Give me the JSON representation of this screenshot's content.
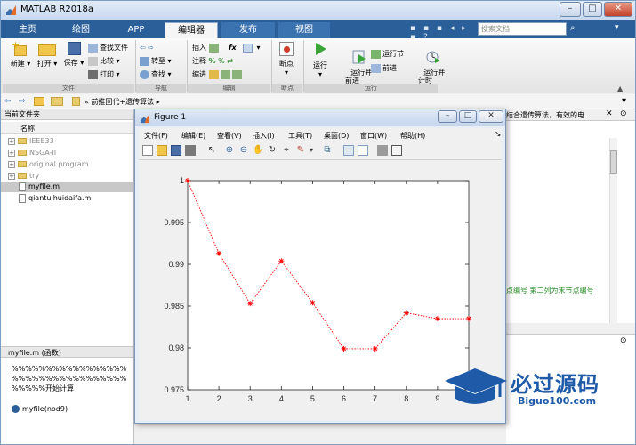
{
  "window": {
    "title": "MATLAB R2018a"
  },
  "tabs": [
    {
      "label": "主页"
    },
    {
      "label": "绘图"
    },
    {
      "label": "APP"
    },
    {
      "label": "编辑器"
    },
    {
      "label": "发布"
    },
    {
      "label": "视图"
    }
  ],
  "search": {
    "placeholder": "搜索文档"
  },
  "ribbon": {
    "file_group": {
      "label": "文件",
      "new": "新建",
      "open": "打开",
      "save": "保存",
      "find_file": "查找文件",
      "compare": "比较",
      "print": "打印"
    },
    "nav_group": {
      "label": "导航",
      "goto": "转至",
      "find": "查找"
    },
    "edit_group": {
      "label": "编辑",
      "insert": "插入",
      "comment": "注释",
      "indent": "缩进",
      "fx": "fx"
    },
    "breakpoint_group": {
      "label": "断点",
      "breakpoints": "断点"
    },
    "run_group": {
      "label": "运行",
      "run": "运行",
      "run_advance": "运行并\n前进",
      "run_section": "运行节",
      "advance": "前进",
      "run_time": "运行并\n计时"
    }
  },
  "address": {
    "path": "« 前推回代+遗传算法 ▸"
  },
  "left_panel": {
    "title": "当前文件夹",
    "column_name": "名称",
    "items": [
      {
        "name": "IEEE33",
        "type": "folder"
      },
      {
        "name": "NSGA-II",
        "type": "folder"
      },
      {
        "name": "original program",
        "type": "folder"
      },
      {
        "name": "try",
        "type": "folder"
      },
      {
        "name": "myfile.m",
        "type": "file"
      },
      {
        "name": "qiantuihuidaifa.m",
        "type": "file"
      }
    ],
    "details_title": "myfile.m  (函数)",
    "details_text": "%%%%%%%%%%%%%%%%%%%%%%%%%%%%%%%%%%%%%%%开始计算",
    "details_function": "myfile(nod9)"
  },
  "right_panel": {
    "header_text": "结合遗传算法，有效的电...",
    "code_comment": "点编号  第二列为末节点编号"
  },
  "figure": {
    "title": "Figure 1",
    "menus": [
      {
        "label": "文件(F)"
      },
      {
        "label": "编辑(E)"
      },
      {
        "label": "查看(V)"
      },
      {
        "label": "插入(I)"
      },
      {
        "label": "工具(T)"
      },
      {
        "label": "桌面(D)"
      },
      {
        "label": "窗口(W)"
      },
      {
        "label": "帮助(H)"
      }
    ]
  },
  "watermark": {
    "text": "必过源码",
    "url": "Biguo100.com"
  },
  "chart_data": {
    "type": "line",
    "title": "",
    "xlabel": "",
    "ylabel": "",
    "x": [
      1,
      2,
      3,
      4,
      5,
      6,
      7,
      8,
      9,
      10
    ],
    "series": [
      {
        "values": [
          1.0,
          0.9913,
          0.9853,
          0.9904,
          0.9854,
          0.9799,
          0.9799,
          0.9842,
          0.9835,
          0.9835
        ],
        "color": "#ff0000",
        "marker": "*",
        "line_style": "dotted"
      }
    ],
    "xlim": [
      1,
      10
    ],
    "ylim": [
      0.975,
      1.0
    ],
    "xticks": [
      "1",
      "2",
      "3",
      "4",
      "5",
      "6",
      "7",
      "8",
      "9"
    ],
    "yticks": [
      "0.975",
      "0.98",
      "0.985",
      "0.99",
      "0.995",
      "1"
    ],
    "grid": false
  }
}
